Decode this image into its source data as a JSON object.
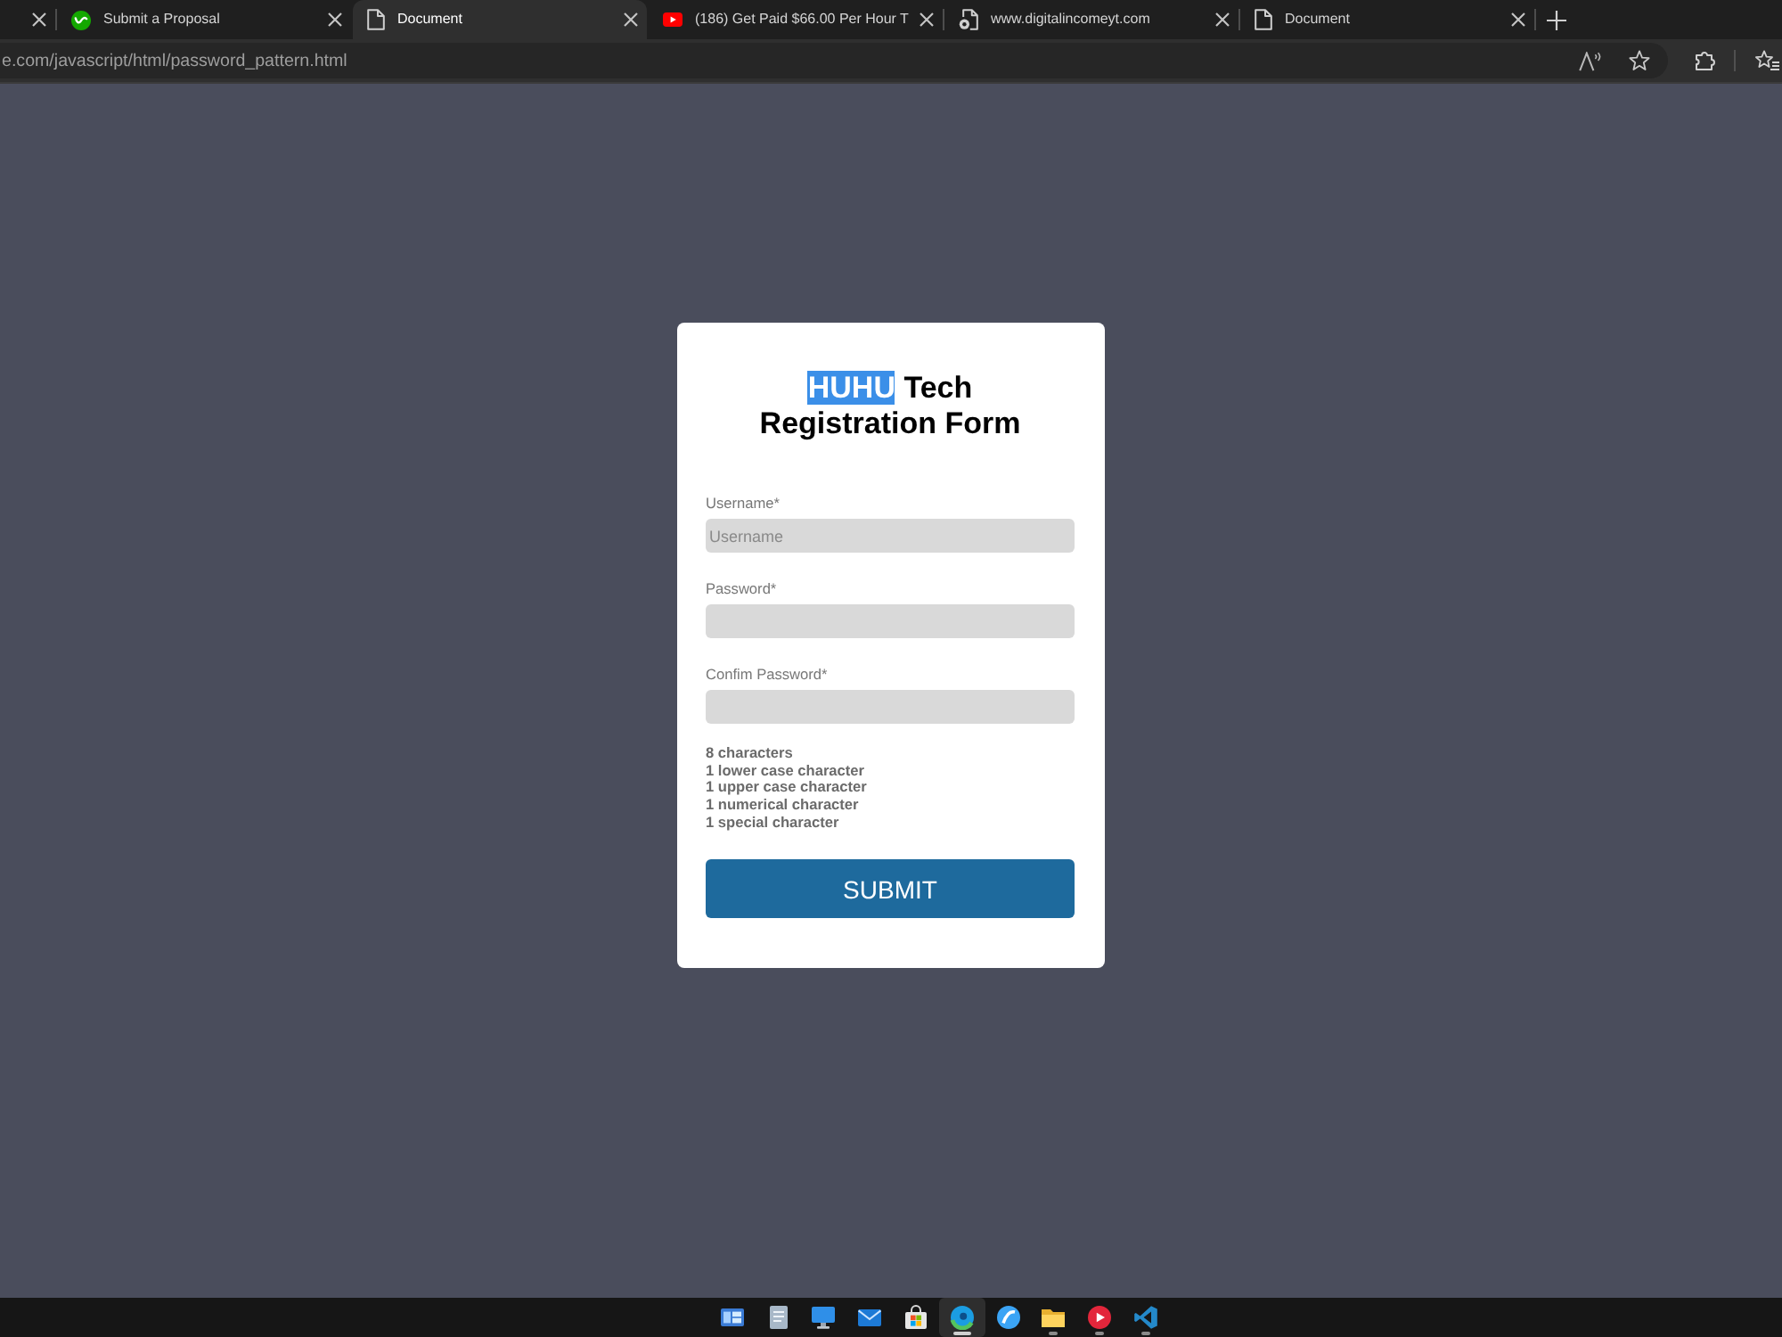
{
  "tabs": [
    {
      "kind": "blank",
      "selected": false
    },
    {
      "kind": "logo",
      "title": "Submit a Proposal",
      "selected": false
    },
    {
      "kind": "page",
      "title": "Document",
      "selected": true
    },
    {
      "kind": "video",
      "title": "(186) Get Paid $66.00 Per Hour T",
      "selected": false
    },
    {
      "kind": "site",
      "title": "www.digitalincomeyt.com",
      "selected": false
    },
    {
      "kind": "page",
      "title": "Document",
      "selected": false
    }
  ],
  "address_bar": {
    "url": "e.com/javascript/html/password_pattern.html"
  },
  "form": {
    "title": {
      "lines": [
        {
          "segments": [
            {
              "text": "HUHU",
              "selected": true
            },
            {
              "text": "Tech",
              "selected": false
            }
          ]
        },
        {
          "segments": [
            {
              "text": "Registration Form",
              "selected": false
            }
          ]
        }
      ]
    },
    "fields": [
      {
        "label": "Username*",
        "placeholder": "Username"
      },
      {
        "label": "Password*"
      },
      {
        "label": "Confim Password*"
      }
    ],
    "requirements": [
      "8 characters",
      "1 lower case character",
      "1 upper case character",
      "1 numerical character",
      "1 special character"
    ],
    "submit_button": "SUBMIT"
  },
  "taskbar": [
    {
      "kind": "widgets",
      "selected": false,
      "running": false
    },
    {
      "kind": "notepad",
      "selected": false,
      "running": false
    },
    {
      "kind": "monitor",
      "selected": false,
      "running": false
    },
    {
      "kind": "mail",
      "selected": false,
      "running": false
    },
    {
      "kind": "store",
      "selected": false,
      "running": false
    },
    {
      "kind": "browser",
      "selected": true,
      "running": true
    },
    {
      "kind": "disc",
      "selected": false,
      "running": false
    },
    {
      "kind": "folder",
      "selected": false,
      "running": true
    },
    {
      "kind": "media",
      "selected": false,
      "running": true
    },
    {
      "kind": "code",
      "selected": false,
      "running": true
    }
  ]
}
